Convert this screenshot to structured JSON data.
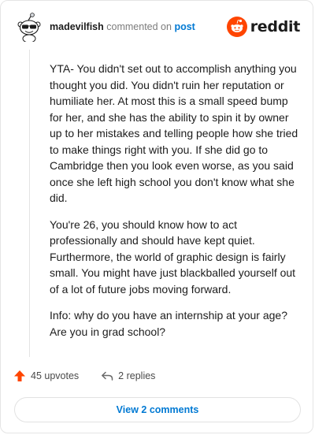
{
  "header": {
    "username": "madevilfish",
    "commented_text": "commented on",
    "post_link": "post",
    "brand": "reddit"
  },
  "comment": {
    "paragraphs": [
      "YTA- You didn't set out to accomplish anything you thought you did. You didn't ruin her reputation or humiliate her. At most this is a small speed bump for her, and she has the ability to spin it by owner up to her mistakes and telling people how she tried to make things right with you. If she did go to Cambridge then you look even worse, as you said once she left high school you don't know what she did.",
      "You're 26, you should know how to act professionally and should have kept quiet. Furthermore, the world of graphic design is fairly small. You might have just blackballed yourself out of a lot of future jobs moving forward.",
      "Info: why do you have an internship at your age? Are you in grad school?"
    ]
  },
  "actions": {
    "upvotes": "45 upvotes",
    "replies": "2 replies"
  },
  "footer": {
    "view_comments": "View 2 comments"
  },
  "colors": {
    "accent": "#ff4500",
    "link": "#0079d3",
    "text": "#1c1c1c",
    "muted": "#7c7c7c"
  },
  "icons": {
    "avatar": "snoo-avatar-with-sunglasses",
    "brand": "reddit-logo-icon",
    "upvote": "upvote-arrow-icon",
    "reply": "reply-arrow-icon"
  }
}
